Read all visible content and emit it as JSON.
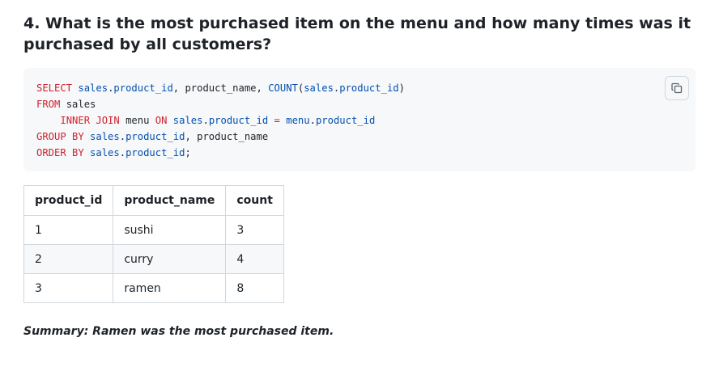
{
  "heading": "4. What is the most purchased item on the menu and how many times was it purchased by all customers?",
  "code": {
    "lines": [
      [
        {
          "t": "SELECT",
          "c": "kw"
        },
        {
          "t": " "
        },
        {
          "t": "sales",
          "c": "id"
        },
        {
          "t": "."
        },
        {
          "t": "product_id",
          "c": "id"
        },
        {
          "t": ", product_name, "
        },
        {
          "t": "COUNT",
          "c": "id"
        },
        {
          "t": "("
        },
        {
          "t": "sales",
          "c": "id"
        },
        {
          "t": "."
        },
        {
          "t": "product_id",
          "c": "id"
        },
        {
          "t": ")"
        }
      ],
      [
        {
          "t": "FROM",
          "c": "kw"
        },
        {
          "t": " sales"
        }
      ],
      [
        {
          "t": "    "
        },
        {
          "t": "INNER JOIN",
          "c": "kw"
        },
        {
          "t": " menu "
        },
        {
          "t": "ON",
          "c": "kw"
        },
        {
          "t": " "
        },
        {
          "t": "sales",
          "c": "id"
        },
        {
          "t": "."
        },
        {
          "t": "product_id",
          "c": "id"
        },
        {
          "t": " "
        },
        {
          "t": "=",
          "c": "kw"
        },
        {
          "t": " "
        },
        {
          "t": "menu",
          "c": "id"
        },
        {
          "t": "."
        },
        {
          "t": "product_id",
          "c": "id"
        }
      ],
      [
        {
          "t": "GROUP BY",
          "c": "kw"
        },
        {
          "t": " "
        },
        {
          "t": "sales",
          "c": "id"
        },
        {
          "t": "."
        },
        {
          "t": "product_id",
          "c": "id"
        },
        {
          "t": ", product_name"
        }
      ],
      [
        {
          "t": "ORDER BY",
          "c": "kw"
        },
        {
          "t": " "
        },
        {
          "t": "sales",
          "c": "id"
        },
        {
          "t": "."
        },
        {
          "t": "product_id",
          "c": "id"
        },
        {
          "t": ";"
        }
      ]
    ],
    "copy_icon": "copy-icon"
  },
  "table": {
    "columns": [
      "product_id",
      "product_name",
      "count"
    ],
    "rows": [
      [
        "1",
        "sushi",
        "3"
      ],
      [
        "2",
        "curry",
        "4"
      ],
      [
        "3",
        "ramen",
        "8"
      ]
    ]
  },
  "summary": "Summary: Ramen was the most purchased item.",
  "colors": {
    "keyword": "#cf222e",
    "identifier": "#0550ae",
    "code_background": "#f6f8fa",
    "border": "#d0d7de",
    "text": "#1f2328"
  }
}
